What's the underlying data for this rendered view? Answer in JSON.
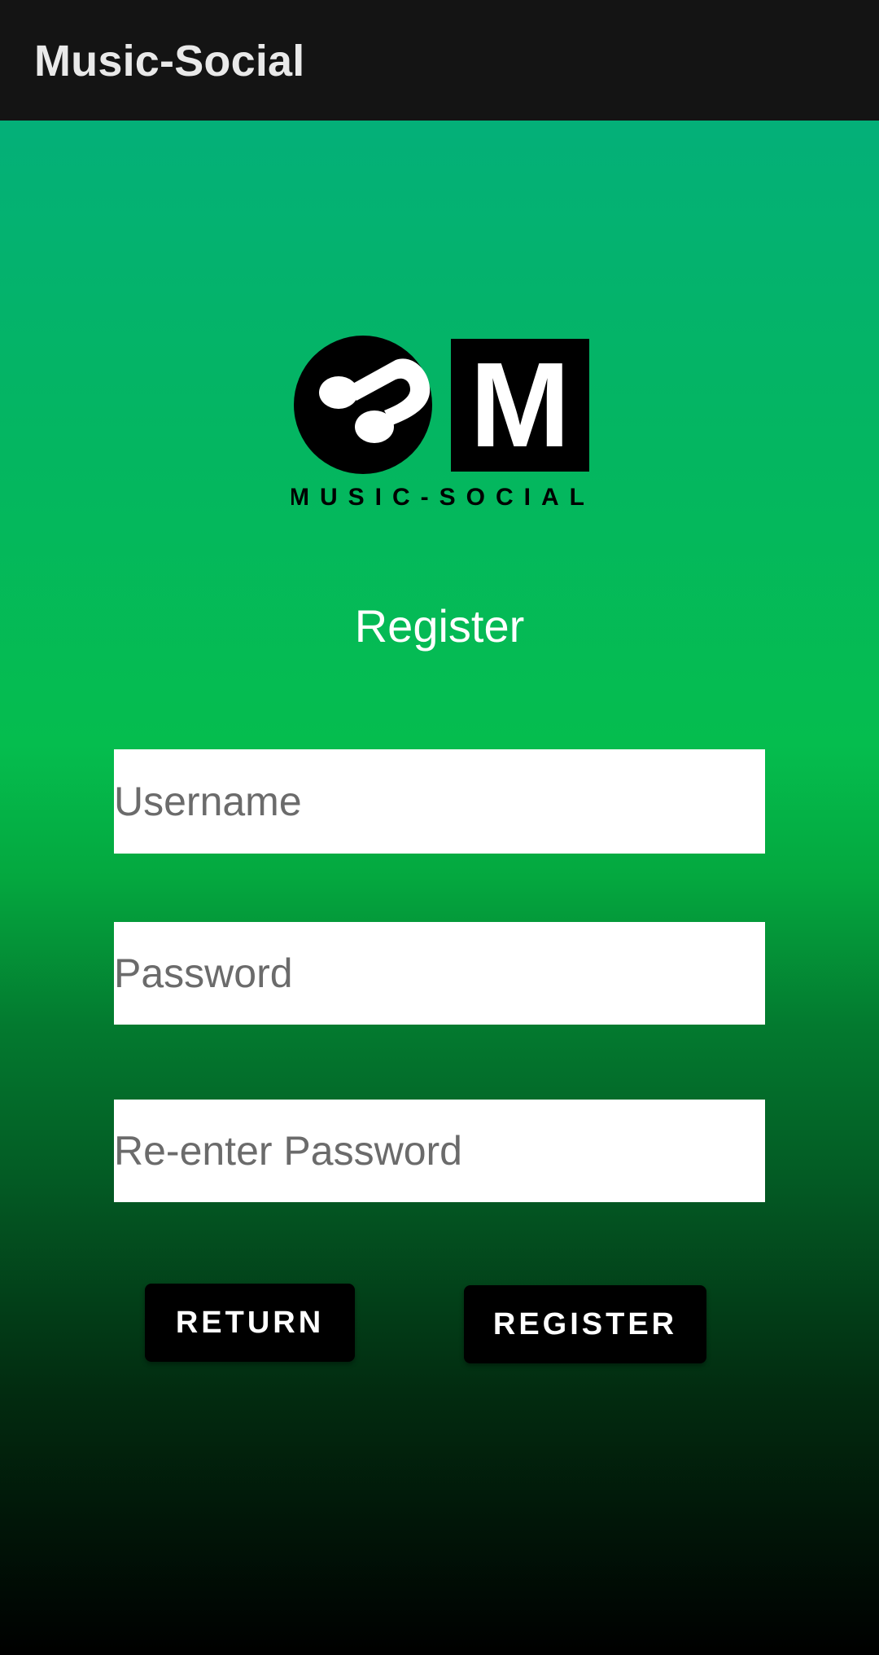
{
  "app_bar": {
    "title": "Music-Social"
  },
  "logo": {
    "monogram": "M",
    "wordmark": "MUSIC-SOCIAL"
  },
  "page": {
    "title": "Register"
  },
  "form": {
    "username": {
      "placeholder": "Username",
      "value": ""
    },
    "password": {
      "placeholder": "Password",
      "value": ""
    },
    "reenter_password": {
      "placeholder": "Re-enter Password",
      "value": ""
    }
  },
  "buttons": {
    "return_label": "RETURN",
    "register_label": "REGISTER"
  },
  "colors": {
    "app_bar_bg": "#141414",
    "gradient_top": "#04ae82",
    "gradient_mid": "#05bd4e",
    "gradient_bottom": "#000000",
    "button_bg": "#000000"
  },
  "icons": {
    "logo_mark": "music-note-icon"
  }
}
